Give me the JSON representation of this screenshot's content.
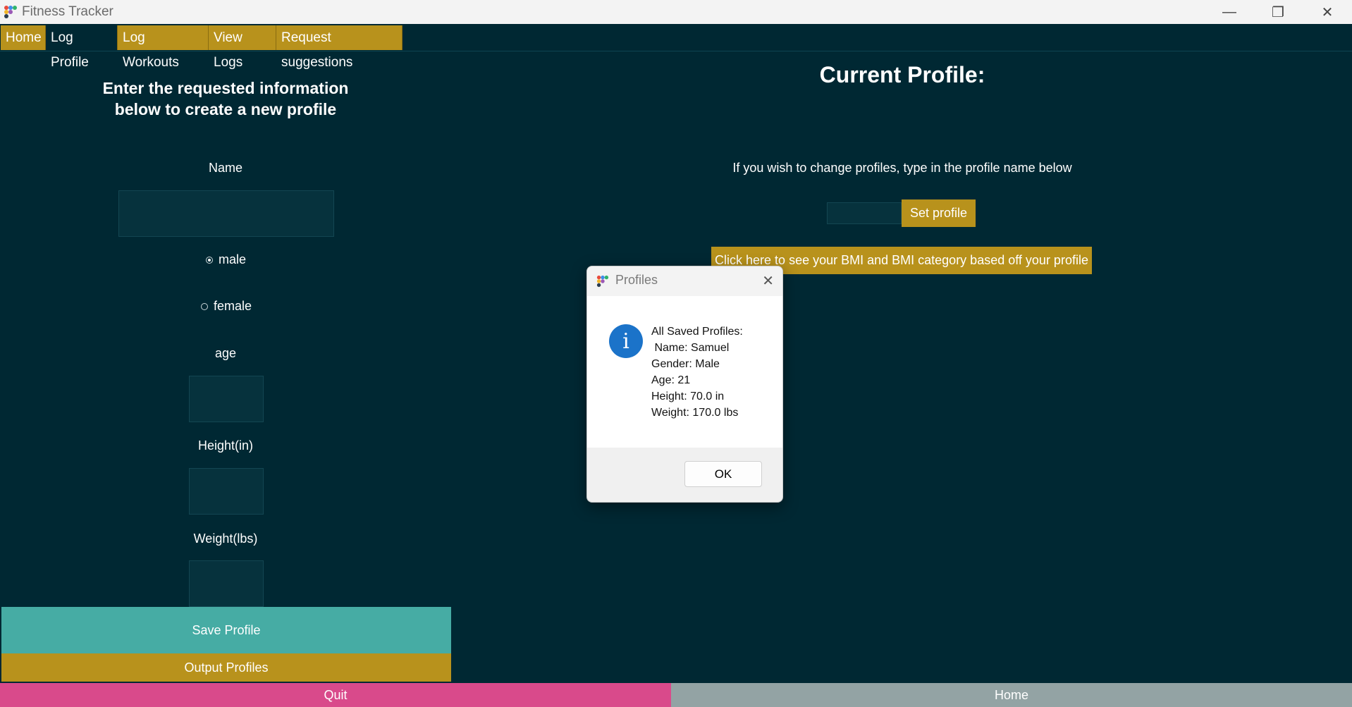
{
  "window": {
    "title": "Fitness Tracker"
  },
  "tabs": [
    {
      "label": "Home"
    },
    {
      "label": "Log Profile",
      "active": true
    },
    {
      "label": "Log Workouts"
    },
    {
      "label": "View Logs"
    },
    {
      "label": "Request suggestions"
    }
  ],
  "left": {
    "heading_line1": "Enter the requested information",
    "heading_line2": "below to create a new profile",
    "name_label": "Name",
    "name_value": "",
    "gender_options": [
      {
        "label": "male",
        "selected": true
      },
      {
        "label": "female",
        "selected": false
      }
    ],
    "age_label": "age",
    "age_value": "",
    "height_label": "Height(in)",
    "height_value": "",
    "weight_label": "Weight(lbs)",
    "weight_value": "",
    "save_button": "Save Profile",
    "output_button": "Output Profiles"
  },
  "right": {
    "title": "Current Profile:",
    "change_text": "If you wish to change profiles, type in the profile name below",
    "profile_input_value": "",
    "set_profile_button": "Set profile",
    "bmi_button": "Click here to see your BMI and BMI category based off your profile"
  },
  "footer": {
    "quit_button": "Quit",
    "home_button": "Home"
  },
  "dialog": {
    "title": "Profiles",
    "message": "All Saved Profiles:\n Name: Samuel\nGender: Male\nAge: 21\nHeight: 70.0 in\nWeight: 170.0 lbs",
    "ok_button": "OK"
  },
  "colors": {
    "background": "#002833",
    "tab_gold": "#b8921c",
    "save_teal": "#46aca4",
    "quit_pink": "#d94a8b",
    "home_gray": "#93a3a4",
    "info_blue": "#1b73c9"
  }
}
